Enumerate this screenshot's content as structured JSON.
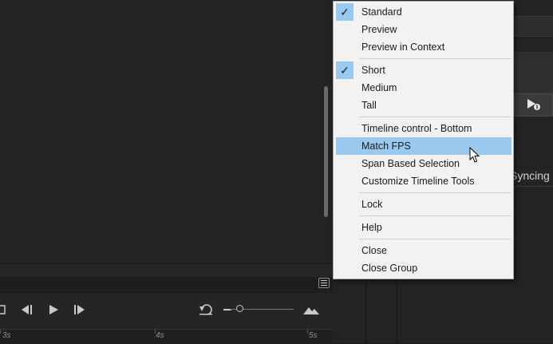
{
  "menu": {
    "items": [
      {
        "label": "Standard",
        "checked": true
      },
      {
        "label": "Preview",
        "checked": false
      },
      {
        "label": "Preview in Context",
        "checked": false
      },
      {
        "label": "Short",
        "checked": true
      },
      {
        "label": "Medium",
        "checked": false
      },
      {
        "label": "Tall",
        "checked": false
      },
      {
        "label": "Timeline control - Bottom",
        "checked": false
      },
      {
        "label": "Match FPS",
        "checked": false,
        "highlighted": true
      },
      {
        "label": "Span Based Selection",
        "checked": false
      },
      {
        "label": "Customize Timeline Tools",
        "checked": false
      },
      {
        "label": "Lock",
        "checked": false
      },
      {
        "label": "Help",
        "checked": false
      },
      {
        "label": "Close",
        "checked": false
      },
      {
        "label": "Close Group",
        "checked": false
      }
    ],
    "checkmark": "✓"
  },
  "ruler": {
    "labels": [
      "3s",
      "4s",
      "5s"
    ]
  },
  "right_panel": {
    "syncing_text": "Syncing"
  },
  "colors": {
    "highlight": "#99c9ef",
    "menu_bg": "#f2f2f2",
    "stage_bg": "#232323"
  },
  "icons": {
    "loop": "loop-icon",
    "step_back": "step-back-icon",
    "play": "play-icon",
    "step_forward": "step-forward-icon",
    "undo": "undo-icon",
    "zoom_out": "zoom-out-icon",
    "zoom_in": "mountain-zoom-icon",
    "menu": "hamburger-menu-icon"
  }
}
